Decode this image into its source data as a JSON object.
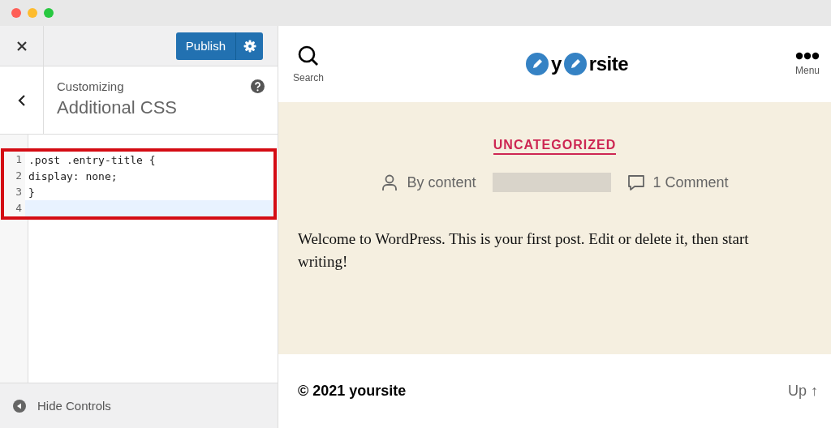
{
  "sidebar": {
    "publish_button": "Publish",
    "section_label": "Customizing",
    "section_title": "Additional CSS",
    "code_lines": [
      {
        "number": "1",
        "text": ".post .entry-title {",
        "current": false
      },
      {
        "number": "2",
        "text": "display: none;",
        "current": false
      },
      {
        "number": "3",
        "text": "}",
        "current": false
      },
      {
        "number": "4",
        "current": true
      }
    ],
    "hide_controls": "Hide Controls"
  },
  "preview": {
    "search_label": "Search",
    "site_title_parts": [
      "y",
      "rsite"
    ],
    "menu_label": "Menu",
    "category": "UNCATEGORIZED",
    "author": "By content",
    "comments": "1 Comment",
    "body": "Welcome to WordPress. This is your first post. Edit or delete it, then start writing!",
    "footer_text": "© 2021 yoursite",
    "up_link": "Up ↑"
  }
}
